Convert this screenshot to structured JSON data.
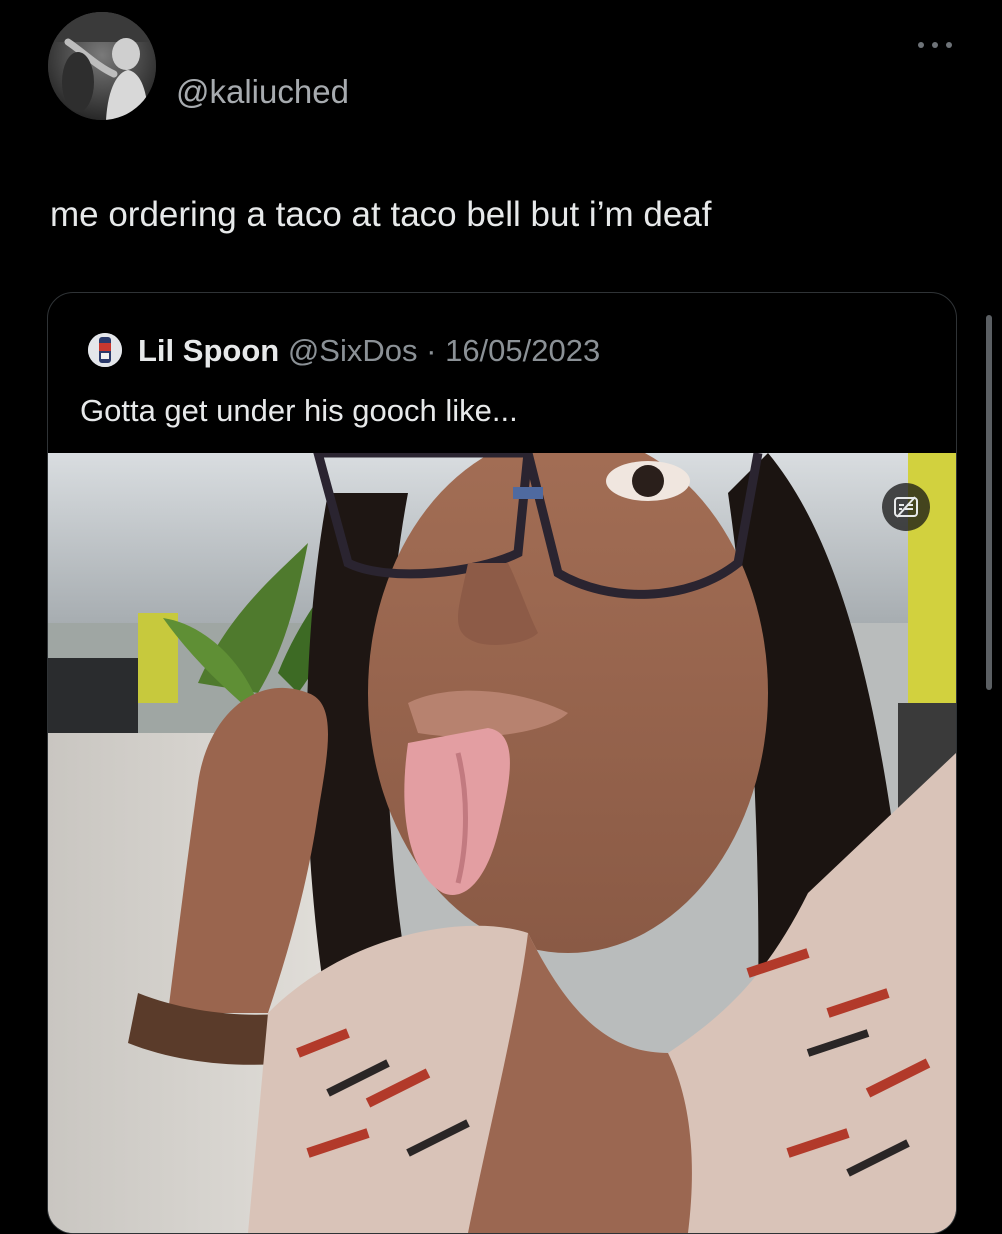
{
  "tweet": {
    "handle": "@kaliuched",
    "text": "me ordering a taco at taco bell but i’m deaf",
    "avatar_icon": "profile-photo"
  },
  "quoted_tweet": {
    "name": "Lil Spoon",
    "handle": "@SixDos",
    "separator": "·",
    "date": "16/05/2023",
    "text": "Gotta get under his gooch like...",
    "media_icon": "closed-captions-icon"
  },
  "colors": {
    "background": "#000000",
    "primary_text": "#e7e9ea",
    "secondary_text": "#8b9196",
    "card_border": "#2f3336"
  }
}
